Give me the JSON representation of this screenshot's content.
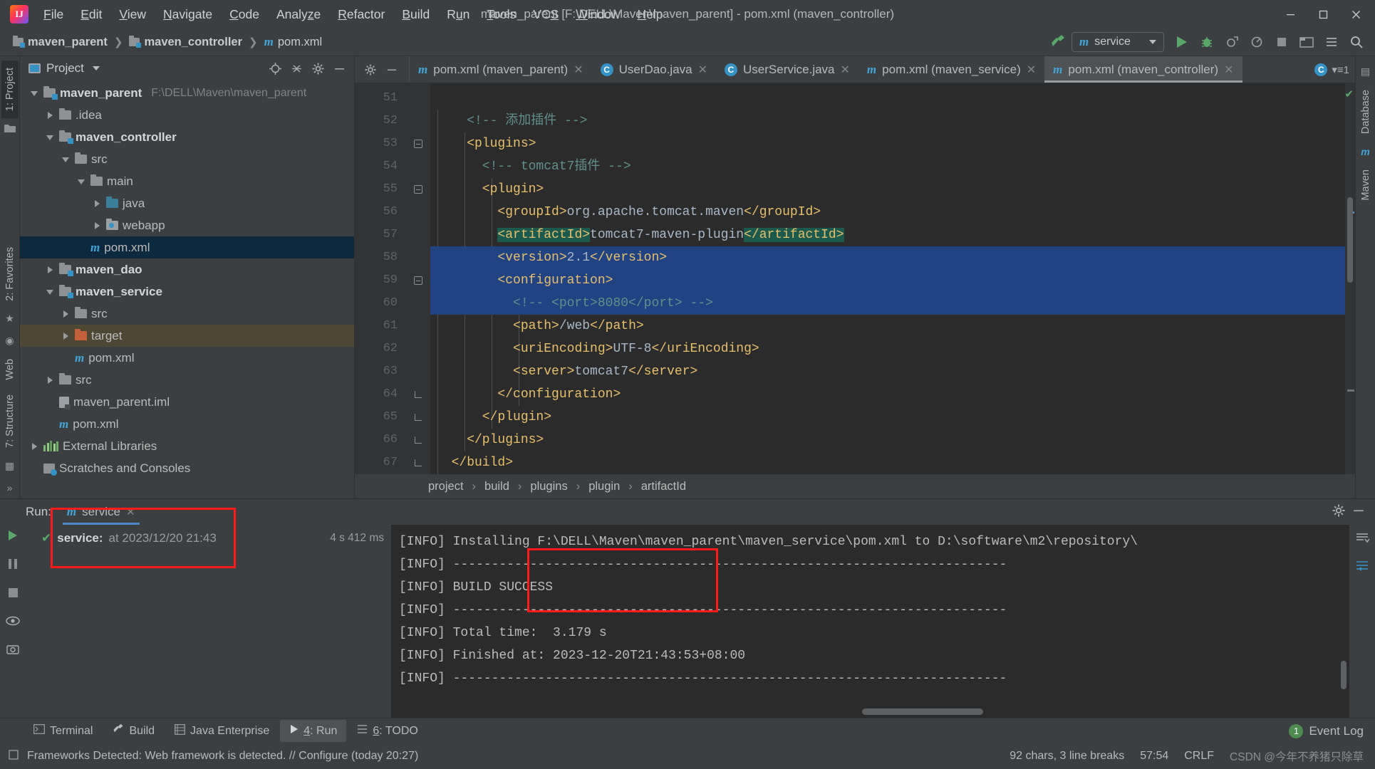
{
  "window": {
    "title": "maven_parent [F:\\DELL\\Maven\\maven_parent] - pom.xml (maven_controller)",
    "minimize": "—",
    "maximize": "▭",
    "close": "✕",
    "logo_text": "IJ"
  },
  "menu": [
    {
      "label": "File"
    },
    {
      "label": "Edit"
    },
    {
      "label": "View"
    },
    {
      "label": "Navigate"
    },
    {
      "label": "Code"
    },
    {
      "label": "Analyze"
    },
    {
      "label": "Refactor"
    },
    {
      "label": "Build"
    },
    {
      "label": "Run"
    },
    {
      "label": "Tools"
    },
    {
      "label": "VCS"
    },
    {
      "label": "Window"
    },
    {
      "label": "Help"
    }
  ],
  "navbar": {
    "crumbs": [
      {
        "label": "maven_parent",
        "icon": "module-folder-icon"
      },
      {
        "label": "maven_controller",
        "icon": "module-folder-icon"
      },
      {
        "label": "pom.xml",
        "icon": "maven-m-icon"
      }
    ],
    "run_config": {
      "label": "service",
      "icon": "maven-m-icon",
      "caret": "▼"
    },
    "buttons": [
      {
        "name": "build-hammer-icon",
        "glyph": "⌁"
      },
      {
        "name": "run-button",
        "glyph": "▶"
      },
      {
        "name": "debug-button",
        "glyph": "🐞"
      },
      {
        "name": "run-with-coverage-button",
        "glyph": "▣"
      },
      {
        "name": "profiler-button",
        "glyph": "◎"
      },
      {
        "name": "stop-button",
        "glyph": "■"
      },
      {
        "name": "update-project-button",
        "glyph": "▤"
      },
      {
        "name": "settings-button",
        "glyph": "⚙"
      },
      {
        "name": "search-everywhere-icon",
        "glyph": "🔍"
      }
    ]
  },
  "left_strip": {
    "tabs": [
      {
        "label": "1: Project",
        "active": true
      },
      {
        "label": "2: Favorites"
      },
      {
        "label": "7: Structure"
      }
    ]
  },
  "right_strip": {
    "tabs": [
      {
        "label": "Database"
      },
      {
        "label": "m Maven"
      }
    ]
  },
  "project_panel": {
    "title": "Project",
    "caret": "▼",
    "tool_icons": [
      "locate-icon",
      "collapse-all-icon",
      "gear-icon",
      "hide-icon"
    ],
    "tree": [
      {
        "depth": 0,
        "arrow": "down",
        "icon": "module-folder",
        "label": "maven_parent",
        "bold": true,
        "path": "F:\\DELL\\Maven\\maven_parent"
      },
      {
        "depth": 1,
        "arrow": "right",
        "icon": "folder",
        "label": ".idea"
      },
      {
        "depth": 1,
        "arrow": "down",
        "icon": "module-folder",
        "label": "maven_controller",
        "bold": true
      },
      {
        "depth": 2,
        "arrow": "down",
        "icon": "folder",
        "label": "src"
      },
      {
        "depth": 3,
        "arrow": "down",
        "icon": "folder",
        "label": "main"
      },
      {
        "depth": 4,
        "arrow": "right",
        "icon": "source-folder",
        "label": "java"
      },
      {
        "depth": 4,
        "arrow": "right",
        "icon": "web-folder",
        "label": "webapp"
      },
      {
        "depth": 3,
        "arrow": "none",
        "icon": "maven-m",
        "label": "pom.xml",
        "selected": true
      },
      {
        "depth": 1,
        "arrow": "right",
        "icon": "module-folder",
        "label": "maven_dao",
        "bold": true
      },
      {
        "depth": 1,
        "arrow": "down",
        "icon": "module-folder",
        "label": "maven_service",
        "bold": true
      },
      {
        "depth": 2,
        "arrow": "right",
        "icon": "folder",
        "label": "src"
      },
      {
        "depth": 2,
        "arrow": "right",
        "icon": "target-folder",
        "label": "target",
        "amber": true
      },
      {
        "depth": 2,
        "arrow": "none",
        "icon": "maven-m",
        "label": "pom.xml"
      },
      {
        "depth": 1,
        "arrow": "right",
        "icon": "folder",
        "label": "src"
      },
      {
        "depth": 1,
        "arrow": "none",
        "icon": "iml-file",
        "label": "maven_parent.iml"
      },
      {
        "depth": 1,
        "arrow": "none",
        "icon": "maven-m",
        "label": "pom.xml"
      },
      {
        "depth": 0,
        "arrow": "right",
        "icon": "library",
        "label": "External Libraries"
      },
      {
        "depth": 0,
        "arrow": "none",
        "icon": "scratches",
        "label": "Scratches and Consoles"
      }
    ]
  },
  "editor": {
    "tabs": [
      {
        "label": "pom.xml (maven_parent)",
        "icon": "maven-m-icon",
        "close": "✕"
      },
      {
        "label": "UserDao.java",
        "icon": "java-class-icon",
        "close": "✕"
      },
      {
        "label": "UserService.java",
        "icon": "java-class-icon",
        "close": "✕"
      },
      {
        "label": "pom.xml (maven_service)",
        "icon": "maven-m-icon",
        "close": "✕"
      },
      {
        "label": "pom.xml (maven_controller)",
        "icon": "maven-m-icon",
        "close": "✕",
        "active": true
      }
    ],
    "tab_tools": [
      "gear-icon",
      "hide-icon"
    ],
    "lines": [
      {
        "n": 51,
        "text": "",
        "fold": null
      },
      {
        "n": 52,
        "text": "    <!-- 添加插件 -->",
        "fold": null
      },
      {
        "n": 53,
        "text": "    <plugins>",
        "fold": "open"
      },
      {
        "n": 54,
        "text": "      <!-- tomcat7插件 -->",
        "fold": null
      },
      {
        "n": 55,
        "text": "      <plugin>",
        "fold": "open"
      },
      {
        "n": 56,
        "text": "        <groupId>org.apache.tomcat.maven</groupId>",
        "fold": null
      },
      {
        "n": 57,
        "text": "        <artifactId>tomcat7-maven-plugin</artifactId>",
        "fold": null
      },
      {
        "n": 58,
        "text": "        <version>2.1</version>",
        "fold": null
      },
      {
        "n": 59,
        "text": "        <configuration>",
        "fold": "open"
      },
      {
        "n": 60,
        "text": "          <!-- <port>8080</port> -->",
        "fold": null
      },
      {
        "n": 61,
        "text": "          <path>/web</path>",
        "fold": null
      },
      {
        "n": 62,
        "text": "          <uriEncoding>UTF-8</uriEncoding>",
        "fold": null
      },
      {
        "n": 63,
        "text": "          <server>tomcat7</server>",
        "fold": null
      },
      {
        "n": 64,
        "text": "        </configuration>",
        "fold": "end"
      },
      {
        "n": 65,
        "text": "      </plugin>",
        "fold": "end"
      },
      {
        "n": 66,
        "text": "    </plugins>",
        "fold": "end"
      },
      {
        "n": 67,
        "text": "  </build>",
        "fold": "end"
      }
    ],
    "breadcrumbs": [
      "project",
      "build",
      "plugins",
      "plugin",
      "artifactId"
    ],
    "breadcrumb_sep": "›"
  },
  "run_panel": {
    "label": "Run:",
    "tab": {
      "label": "service",
      "icon": "maven-m-icon",
      "close": "✕"
    },
    "header_icons": [
      "gear-icon",
      "hide-icon"
    ],
    "side_icons": [
      "rerun-icon",
      "pause-icon",
      "stop-icon",
      "eye-icon",
      "camera-icon"
    ],
    "tree_row": {
      "status_icon": "check-icon",
      "name": "service:",
      "at": "at 2023/12/20 21:43",
      "duration": "4 s 412 ms"
    },
    "console_right_icons": [
      "scroll-to-end-icon",
      "soft-wrap-icon"
    ],
    "console": [
      "[INFO] Installing F:\\DELL\\Maven\\maven_parent\\maven_service\\pom.xml to D:\\software\\m2\\repository\\",
      "[INFO] ------------------------------------------------------------------------",
      "[INFO] BUILD SUCCESS",
      "[INFO] ------------------------------------------------------------------------",
      "[INFO] Total time:  3.179 s",
      "[INFO] Finished at: 2023-12-20T21:43:53+08:00",
      "[INFO] ------------------------------------------------------------------------"
    ]
  },
  "tool_windows": [
    {
      "label": "Terminal",
      "icon": "terminal-icon"
    },
    {
      "label": "Build",
      "icon": "hammer-icon"
    },
    {
      "label": "Java Enterprise",
      "icon": "java-ee-icon"
    },
    {
      "label": "4: Run",
      "icon": "run-icon",
      "active": true
    },
    {
      "label": "6: TODO",
      "icon": "todo-icon"
    }
  ],
  "event_log": {
    "count": "1",
    "label": "Event Log"
  },
  "status_bar": {
    "message": "Frameworks Detected: Web framework is detected. // Configure (today 20:27)",
    "chars": "92 chars, 3 line breaks",
    "caret": "57:54",
    "line_sep": "CRLF",
    "watermark": "CSDN @今年不养猪只除草"
  },
  "colors": {
    "accent_blue": "#3592c4",
    "selection_blue": "#214283",
    "green": "#59a869",
    "amber": "#4e4733",
    "red_annotation": "#ff1a1a"
  }
}
